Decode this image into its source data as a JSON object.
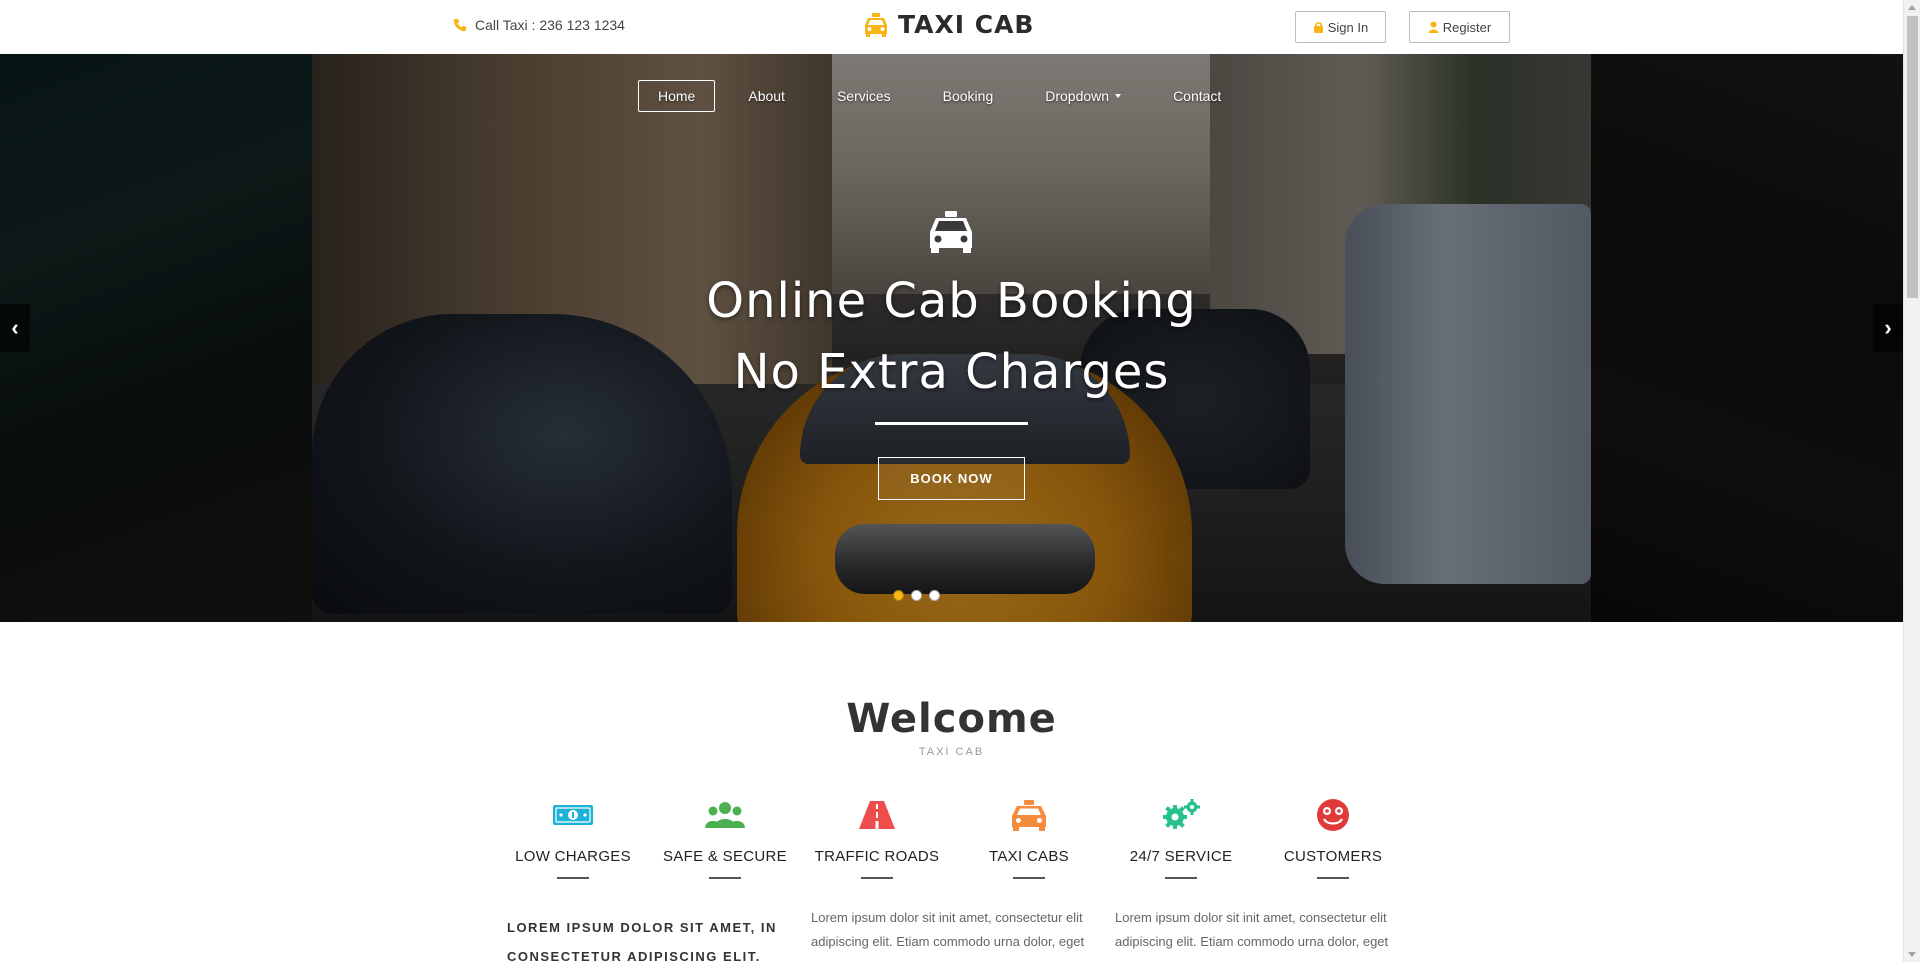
{
  "header": {
    "call_text": "Call Taxi : 236 123 1234",
    "brand": "TAXI CAB",
    "signin_label": "Sign In",
    "register_label": "Register"
  },
  "nav": {
    "items": [
      {
        "label": "Home",
        "active": true
      },
      {
        "label": "About"
      },
      {
        "label": "Services"
      },
      {
        "label": "Booking"
      },
      {
        "label": "Dropdown",
        "has_caret": true
      },
      {
        "label": "Contact"
      }
    ]
  },
  "hero": {
    "title_line1": "Online Cab Booking",
    "title_line2": "No Extra Charges",
    "cta_label": "BOOK NOW",
    "slides": 3,
    "active_slide": 1,
    "prev_arrow": "‹",
    "next_arrow": "›"
  },
  "welcome": {
    "title": "Welcome",
    "subtitle": "TAXI CAB",
    "features": [
      {
        "label": "LOW CHARGES",
        "icon": "money-icon",
        "color": "#1fb2d9"
      },
      {
        "label": "SAFE & SECURE",
        "icon": "users-icon",
        "color": "#4caf50"
      },
      {
        "label": "TRAFFIC ROADS",
        "icon": "road-icon",
        "color": "#ef4d4d"
      },
      {
        "label": "TAXI CABS",
        "icon": "taxi-icon",
        "color": "#f58b3c"
      },
      {
        "label": "24/7 SERVICE",
        "icon": "gears-icon",
        "color": "#27c28c"
      },
      {
        "label": "CUSTOMERS",
        "icon": "smile-icon",
        "color": "#e03a3a"
      }
    ],
    "lead_text": "LOREM IPSUM DOLOR SIT AMET, IN CONSECTETUR ADIPISCING ELIT.",
    "para1": "Lorem ipsum dolor sit init amet, consectetur elit adipiscing elit. Etiam commodo urna dolor, eget",
    "para2": "Lorem ipsum dolor sit init amet, consectetur elit adipiscing elit. Etiam commodo urna dolor, eget"
  },
  "colors": {
    "accent": "#f7b513",
    "text_dark": "#2b2b2b"
  }
}
